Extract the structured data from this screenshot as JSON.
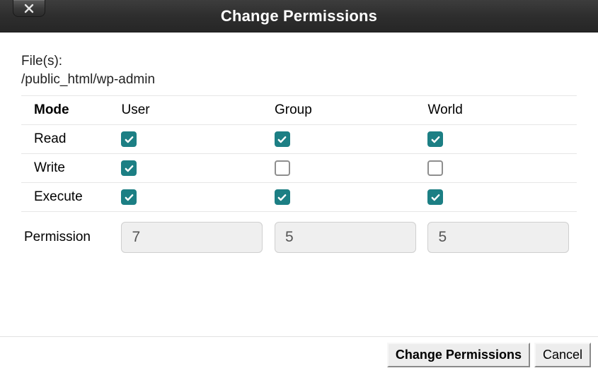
{
  "titlebar": {
    "title": "Change Permissions"
  },
  "files": {
    "label": "File(s):",
    "path": "/public_html/wp-admin"
  },
  "table": {
    "headers": {
      "mode": "Mode",
      "user": "User",
      "group": "Group",
      "world": "World"
    },
    "rows": {
      "read": {
        "label": "Read",
        "user": true,
        "group": true,
        "world": true
      },
      "write": {
        "label": "Write",
        "user": true,
        "group": false,
        "world": false
      },
      "execute": {
        "label": "Execute",
        "user": true,
        "group": true,
        "world": true
      }
    },
    "permission": {
      "label": "Permission",
      "user": "7",
      "group": "5",
      "world": "5"
    }
  },
  "footer": {
    "change": "Change Permissions",
    "cancel": "Cancel"
  },
  "colors": {
    "accent": "#1c7f84"
  }
}
